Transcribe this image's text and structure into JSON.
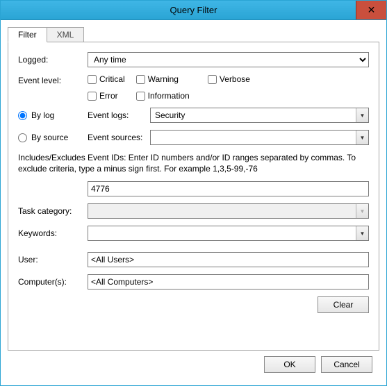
{
  "window": {
    "title": "Query Filter"
  },
  "tabs": {
    "filter": "Filter",
    "xml": "XML"
  },
  "labels": {
    "logged": "Logged:",
    "eventLevel": "Event level:",
    "byLog": "By log",
    "bySource": "By source",
    "eventLogs": "Event logs:",
    "eventSources": "Event sources:",
    "taskCategory": "Task category:",
    "keywords": "Keywords:",
    "user": "User:",
    "computers": "Computer(s):"
  },
  "checkboxes": {
    "critical": "Critical",
    "warning": "Warning",
    "verbose": "Verbose",
    "error": "Error",
    "information": "Information"
  },
  "values": {
    "logged": "Any time",
    "eventLogs": "Security",
    "eventSources": "",
    "eventIds": "4776",
    "taskCategory": "",
    "keywords": "",
    "user": "<All Users>",
    "computers": "<All Computers>",
    "filterMode": "bylog"
  },
  "helpText": "Includes/Excludes Event IDs: Enter ID numbers and/or ID ranges separated by commas. To exclude criteria, type a minus sign first. For example 1,3,5-99,-76",
  "buttons": {
    "clear": "Clear",
    "ok": "OK",
    "cancel": "Cancel"
  }
}
